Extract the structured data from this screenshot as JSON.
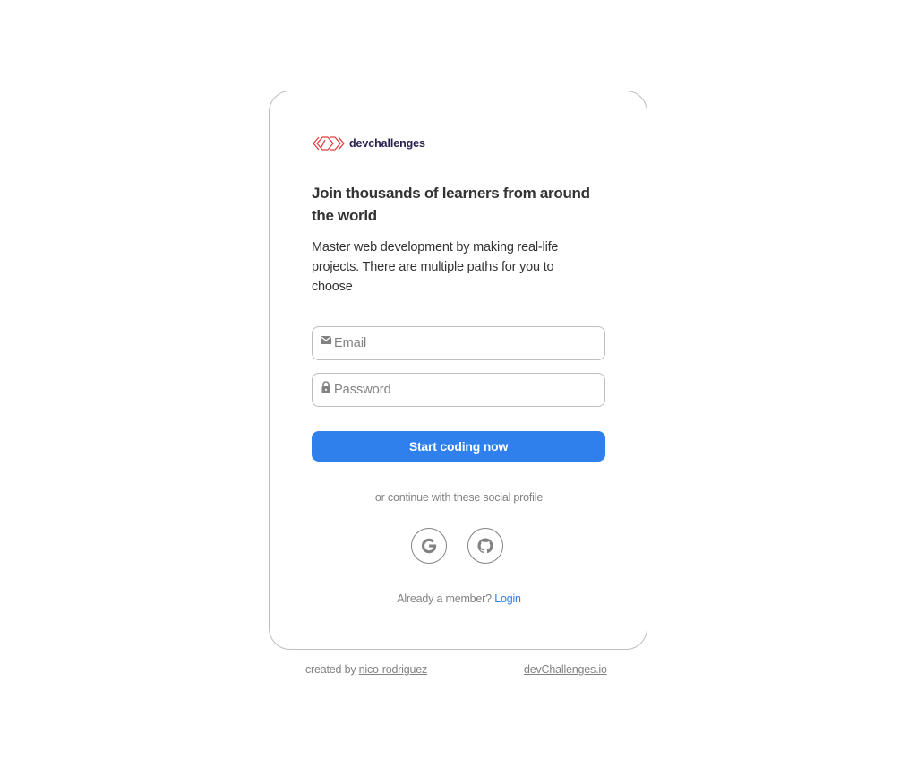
{
  "brand": {
    "name": "devchallenges",
    "accent_color": "#2f80ed",
    "logo_color": "#e53e3e"
  },
  "signup": {
    "headline": "Join thousands of learners from around the world",
    "subtext": "Master web development by making real-life projects. There are multiple paths for you to choose",
    "email": {
      "placeholder": "Email",
      "icon": "mail-icon"
    },
    "password": {
      "placeholder": "Password",
      "icon": "lock-icon"
    },
    "submit_label": "Start coding now",
    "social_caption": "or continue with these social profile",
    "social": [
      {
        "name": "Google",
        "icon": "google-icon"
      },
      {
        "name": "GitHub",
        "icon": "github-icon"
      }
    ],
    "member_prompt": "Already a member?",
    "login_label": "Login"
  },
  "footer": {
    "created_by_label": "created by",
    "author": "nico-rodriguez",
    "site": "devChallenges.io"
  }
}
